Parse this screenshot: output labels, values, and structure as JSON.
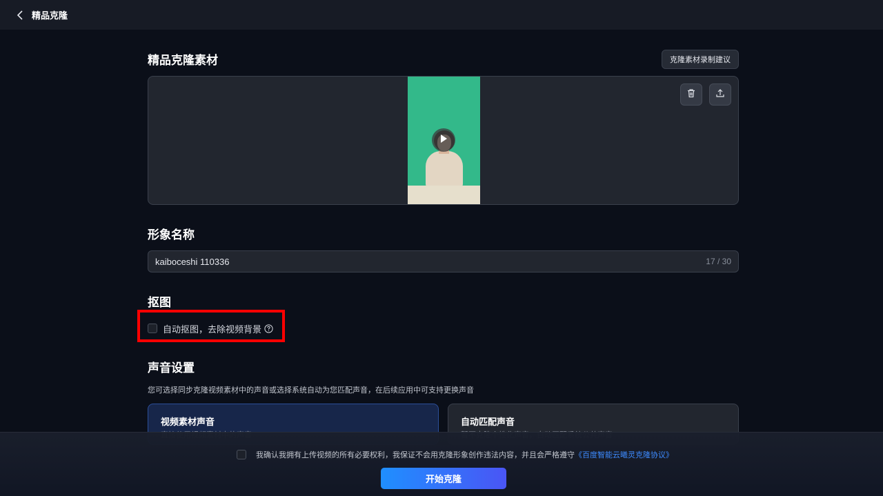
{
  "header": {
    "title": "精品克隆"
  },
  "material": {
    "title": "精品克隆素材",
    "tip_button": "克隆素材录制建议"
  },
  "avatar_name": {
    "title": "形象名称",
    "value": "kaiboceshi 110336",
    "counter": "17 / 30"
  },
  "matting": {
    "title": "抠图",
    "checkbox_label": "自动抠图，去除视频背景"
  },
  "voice": {
    "title": "声音设置",
    "description": "您可选择同步克隆视频素材中的声音或选择系统自动为您匹配声音，在后续应用中可支持更换声音",
    "options": [
      {
        "title": "视频素材声音",
        "subtitle": "直接使用视频素材中的声音"
      },
      {
        "title": "自动匹配声音",
        "subtitle": "暂不克隆个性化声音，自动匹配系统公共声音"
      }
    ]
  },
  "footer": {
    "agreement_text": "我确认我拥有上传视频的所有必要权利，我保证不会用克隆形象创作违法内容，并且会严格遵守",
    "agreement_link": "《百度智能云曦灵克隆协议》",
    "start_button": "开始克隆"
  },
  "colors": {
    "accent": "#3d8bff",
    "highlight": "#ff0000",
    "video_background": "#33b98a"
  }
}
